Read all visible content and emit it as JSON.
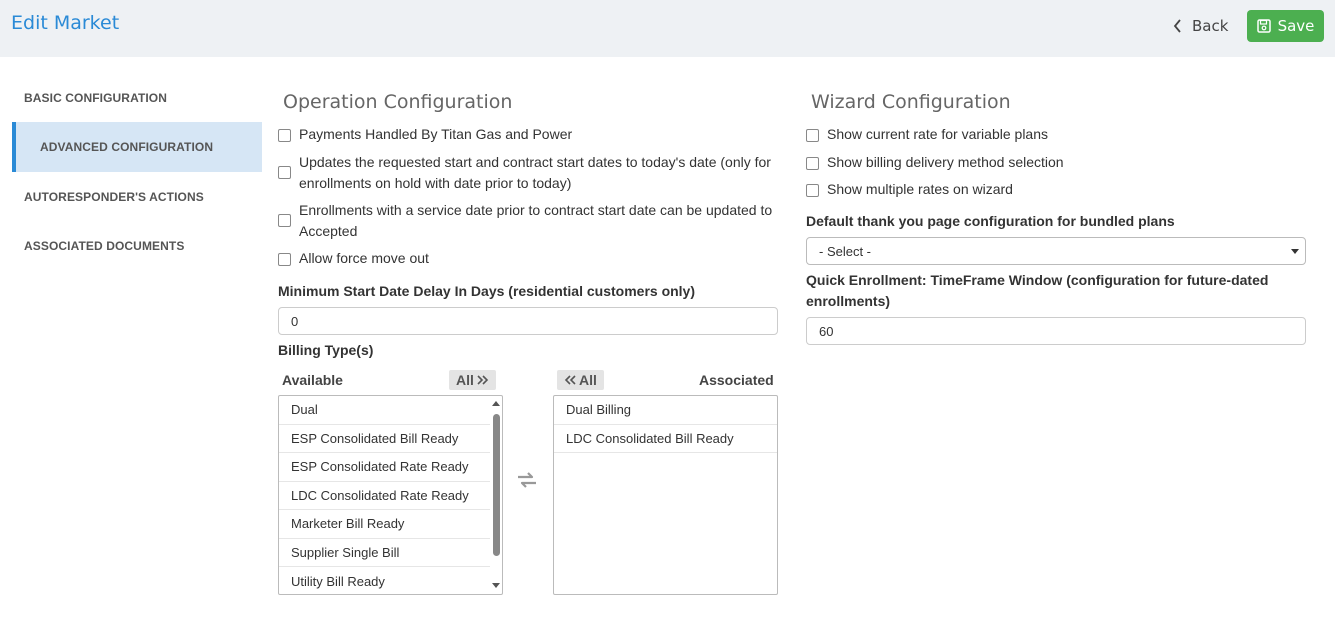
{
  "header": {
    "title": "Edit Market",
    "back_label": "Back",
    "save_label": "Save",
    "save_color": "#4caf50",
    "title_color": "#2a8ad6"
  },
  "sidebar": {
    "items": [
      {
        "label": "BASIC CONFIGURATION",
        "active": false
      },
      {
        "label": "ADVANCED CONFIGURATION",
        "active": true
      },
      {
        "label": "AUTORESPONDER'S ACTIONS",
        "active": false
      },
      {
        "label": "ASSOCIATED DOCUMENTS",
        "active": false
      }
    ]
  },
  "operation": {
    "title": "Operation Configuration",
    "checks": [
      {
        "label": "Payments Handled By Titan Gas and Power",
        "checked": false
      },
      {
        "label": "Updates the requested start and contract start dates to today's date (only for enrollments on hold with date prior to today)",
        "checked": false
      },
      {
        "label": "Enrollments with a service date prior to contract start date can be updated to Accepted",
        "checked": false
      },
      {
        "label": "Allow force move out",
        "checked": false
      }
    ],
    "min_delay_label": "Minimum Start Date Delay In Days (residential customers only)",
    "min_delay_value": "0",
    "billing_label": "Billing Type(s)",
    "available_label": "Available",
    "associated_label": "Associated",
    "all_label": "All",
    "available_items": [
      "Dual",
      "ESP Consolidated Bill Ready",
      "ESP Consolidated Rate Ready",
      "LDC Consolidated Rate Ready",
      "Marketer Bill Ready",
      "Supplier Single Bill",
      "Utility Bill Ready"
    ],
    "associated_items": [
      "Dual Billing",
      "LDC Consolidated Bill Ready"
    ]
  },
  "wizard": {
    "title": "Wizard Configuration",
    "checks": [
      {
        "label": "Show current rate for variable plans",
        "checked": false
      },
      {
        "label": "Show billing delivery method selection",
        "checked": false
      },
      {
        "label": "Show multiple rates on wizard",
        "checked": false
      }
    ],
    "thankyou_label": "Default thank you page configuration for bundled plans",
    "thankyou_value": "- Select -",
    "timeframe_label": "Quick Enrollment: TimeFrame Window (configuration for future-dated enrollments)",
    "timeframe_value": "60"
  }
}
